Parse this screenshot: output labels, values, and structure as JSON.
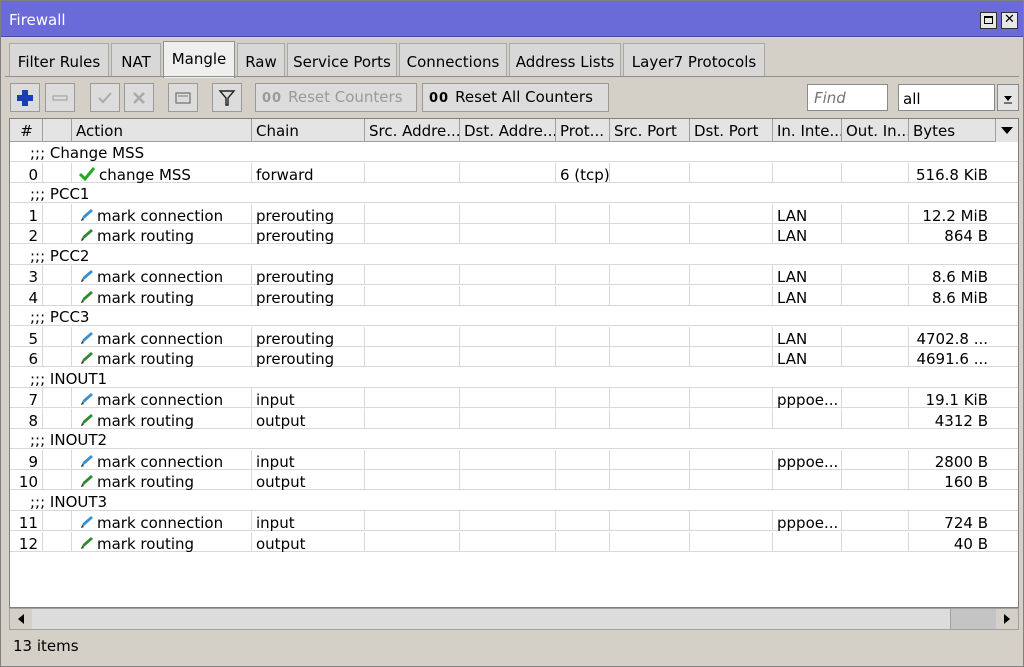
{
  "window": {
    "title": "Firewall"
  },
  "tabs": [
    {
      "label": "Filter Rules"
    },
    {
      "label": "NAT"
    },
    {
      "label": "Mangle",
      "active": true
    },
    {
      "label": "Raw"
    },
    {
      "label": "Service Ports"
    },
    {
      "label": "Connections"
    },
    {
      "label": "Address Lists"
    },
    {
      "label": "Layer7 Protocols"
    }
  ],
  "toolbar": {
    "reset_counters": "Reset Counters",
    "reset_all_counters": "Reset All Counters",
    "oo_glyph": "00",
    "find_placeholder": "Find",
    "filter_value": "all"
  },
  "columns": [
    "#",
    "",
    "Action",
    "Chain",
    "Src. Addre...",
    "Dst. Addre...",
    "Prot...",
    "Src. Port",
    "Dst. Port",
    "In. Inte...",
    "Out. In...",
    "Bytes"
  ],
  "rows": [
    {
      "comment": ";;; Change MSS"
    },
    {
      "num": "0",
      "icon": "check",
      "action": "change MSS",
      "chain": "forward",
      "proto": "6 (tcp)",
      "inif": "",
      "bytes": "516.8 KiB"
    },
    {
      "comment": ";;; PCC1"
    },
    {
      "num": "1",
      "icon": "pencil-blue",
      "action": "mark connection",
      "chain": "prerouting",
      "proto": "",
      "inif": "LAN",
      "bytes": "12.2 MiB"
    },
    {
      "num": "2",
      "icon": "pencil-green",
      "action": "mark routing",
      "chain": "prerouting",
      "proto": "",
      "inif": "LAN",
      "bytes": "864 B"
    },
    {
      "comment": ";;; PCC2"
    },
    {
      "num": "3",
      "icon": "pencil-blue",
      "action": "mark connection",
      "chain": "prerouting",
      "proto": "",
      "inif": "LAN",
      "bytes": "8.6 MiB"
    },
    {
      "num": "4",
      "icon": "pencil-green",
      "action": "mark routing",
      "chain": "prerouting",
      "proto": "",
      "inif": "LAN",
      "bytes": "8.6 MiB"
    },
    {
      "comment": ";;; PCC3"
    },
    {
      "num": "5",
      "icon": "pencil-blue",
      "action": "mark connection",
      "chain": "prerouting",
      "proto": "",
      "inif": "LAN",
      "bytes": "4702.8 ..."
    },
    {
      "num": "6",
      "icon": "pencil-green",
      "action": "mark routing",
      "chain": "prerouting",
      "proto": "",
      "inif": "LAN",
      "bytes": "4691.6 ..."
    },
    {
      "comment": ";;; INOUT1"
    },
    {
      "num": "7",
      "icon": "pencil-blue",
      "action": "mark connection",
      "chain": "input",
      "proto": "",
      "inif": "pppoe...",
      "bytes": "19.1 KiB"
    },
    {
      "num": "8",
      "icon": "pencil-green",
      "action": "mark routing",
      "chain": "output",
      "proto": "",
      "inif": "",
      "bytes": "4312 B"
    },
    {
      "comment": ";;; INOUT2"
    },
    {
      "num": "9",
      "icon": "pencil-blue",
      "action": "mark connection",
      "chain": "input",
      "proto": "",
      "inif": "pppoe...",
      "bytes": "2800 B"
    },
    {
      "num": "10",
      "icon": "pencil-green",
      "action": "mark routing",
      "chain": "output",
      "proto": "",
      "inif": "",
      "bytes": "160 B"
    },
    {
      "comment": ";;; INOUT3"
    },
    {
      "num": "11",
      "icon": "pencil-blue",
      "action": "mark connection",
      "chain": "input",
      "proto": "",
      "inif": "pppoe...",
      "bytes": "724 B"
    },
    {
      "num": "12",
      "icon": "pencil-green",
      "action": "mark routing",
      "chain": "output",
      "proto": "",
      "inif": "",
      "bytes": "40 B"
    }
  ],
  "status": {
    "items": "13 items"
  },
  "icons": {
    "add": "plus-icon",
    "remove": "minus-icon",
    "enable": "check-icon",
    "disable": "cross-icon",
    "comment": "comment-icon",
    "filter": "funnel-icon"
  },
  "colors": {
    "titlebar": "#6b6ad9",
    "check": "#22aa22",
    "pencil_blue": "#3a8fd0",
    "pencil_green": "#2e8b2e",
    "add": "#1a3fb0"
  }
}
